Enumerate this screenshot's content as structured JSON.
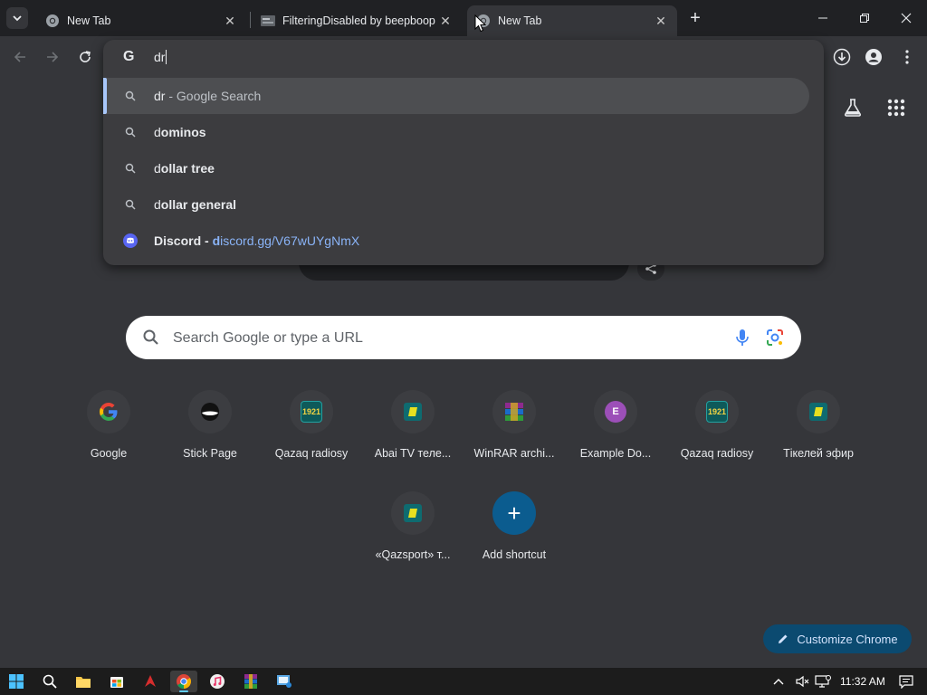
{
  "colors": {
    "accent": "#a8c7fa",
    "link": "#8ab4f8",
    "customize_bg": "#0b4a70",
    "add_shortcut_bg": "#0b5c8f"
  },
  "tabs": [
    {
      "title": "New Tab",
      "icon": "chrome-icon"
    },
    {
      "title": "FilteringDisabled by beepboop",
      "icon": "page-thumbnail-icon"
    },
    {
      "title": "New Tab",
      "icon": "chrome-icon",
      "active": true
    }
  ],
  "omnibox": {
    "typed": "dr",
    "suggestions": [
      {
        "bold": "dr",
        "rest": "",
        "suffix": " - Google Search",
        "type": "search"
      },
      {
        "plain": "d",
        "bold": "ominos",
        "type": "search"
      },
      {
        "plain": "d",
        "bold": "ollar tree",
        "type": "search"
      },
      {
        "plain": "d",
        "bold": "ollar general",
        "type": "search"
      },
      {
        "plain": "Discord - ",
        "url_plain": "d",
        "url_rest": "iscord.gg/V67wUYgNmX",
        "type": "site"
      }
    ]
  },
  "search": {
    "placeholder": "Search Google or type a URL"
  },
  "shortcuts": [
    {
      "label": "Google",
      "icon": "google-icon"
    },
    {
      "label": "Stick Page",
      "icon": "stick-page-icon"
    },
    {
      "label": "Qazaq radiosy",
      "icon": "qazaq-radio-icon",
      "badge": "1921"
    },
    {
      "label": "Abai TV теле...",
      "icon": "abai-tv-icon"
    },
    {
      "label": "WinRAR archi...",
      "icon": "winrar-icon"
    },
    {
      "label": "Example Do...",
      "icon": "letter-e-icon",
      "badge": "E"
    },
    {
      "label": "Qazaq radiosy",
      "icon": "qazaq-radio-icon",
      "badge": "1921"
    },
    {
      "label": "Тікелей эфир",
      "icon": "tv-icon"
    },
    {
      "label": "«Qazsport» т...",
      "icon": "qazsport-icon"
    },
    {
      "label": "Add shortcut",
      "icon": "plus-icon",
      "badge": "+"
    }
  ],
  "customize_label": "Customize Chrome",
  "taskbar": {
    "time": "11:32 AM"
  }
}
